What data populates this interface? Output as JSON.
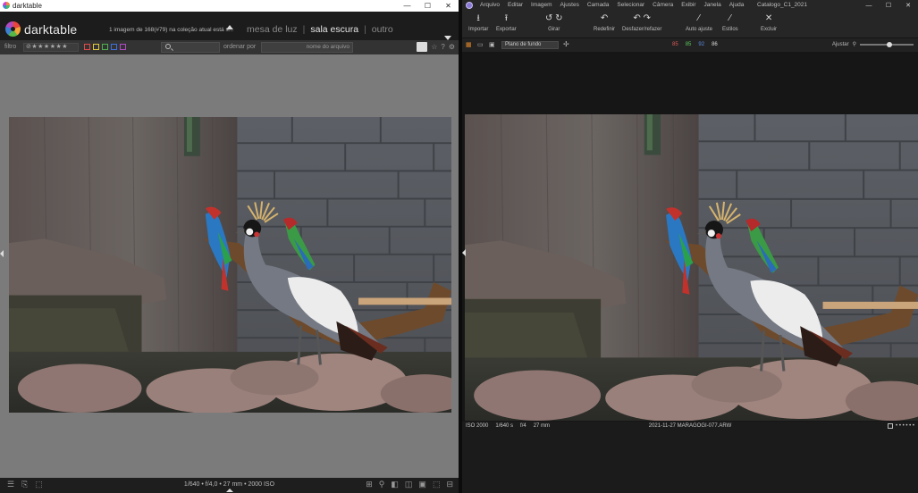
{
  "darktable": {
    "window_title": "darktable",
    "window_controls": {
      "minimize": "—",
      "maximize": "☐",
      "close": "✕"
    },
    "brand": "darktable",
    "collection_info": "1 imagem de 168(#79) na coleção atual está s...",
    "views": [
      "mesa de luz",
      "sala escura",
      "outro"
    ],
    "active_view": "sala escura",
    "filter_label": "filtro",
    "rating_display": "⊘★★★★★★",
    "color_labels": [
      "#e04b4b",
      "#e2c93a",
      "#4fb24f",
      "#3e6ee0",
      "#b04ac4"
    ],
    "sort_label": "ordenar por",
    "sort_value": "nome do arquivo",
    "exif_line": "1/640 • f/4,0 • 27 mm • 2000 ISO",
    "footer_left_icons": [
      "☰",
      "⎘",
      "⬚"
    ],
    "footer_right_icons": [
      "⊞",
      "⚲",
      "◧",
      "◫",
      "▣",
      "⬚",
      "⊟"
    ]
  },
  "captureone": {
    "menus": [
      "Arquivo",
      "Editar",
      "Imagem",
      "Ajustes",
      "Camada",
      "Selecionar",
      "Câmera",
      "Exibir",
      "Janela",
      "Ajuda"
    ],
    "doc_title": "Catalogo_C1_2021",
    "window_controls": {
      "minimize": "—",
      "maximize": "☐",
      "close": "✕"
    },
    "tools": {
      "import": "Importar",
      "export": "Exportar",
      "rotate": "Girar",
      "redo_all": "Redefinir",
      "undo_redo": "Desfazer/refazer",
      "auto_adjust": "Auto ajuste",
      "styles": "Estilos",
      "delete": "Excluir"
    },
    "background_select": "Plano de fundo",
    "rgb_readout": {
      "r": "85",
      "g": "85",
      "b": "92",
      "l": "86"
    },
    "zoom_label": "Ajustar",
    "zoom_level": 0.55,
    "caption": {
      "iso": "ISO 2000",
      "shutter": "1/640 s",
      "aperture": "f/4",
      "focal": "27 mm",
      "filename": "2021-11-27 MARAGOGI-077.ARW"
    },
    "caption_dots": "• • • • • •"
  }
}
